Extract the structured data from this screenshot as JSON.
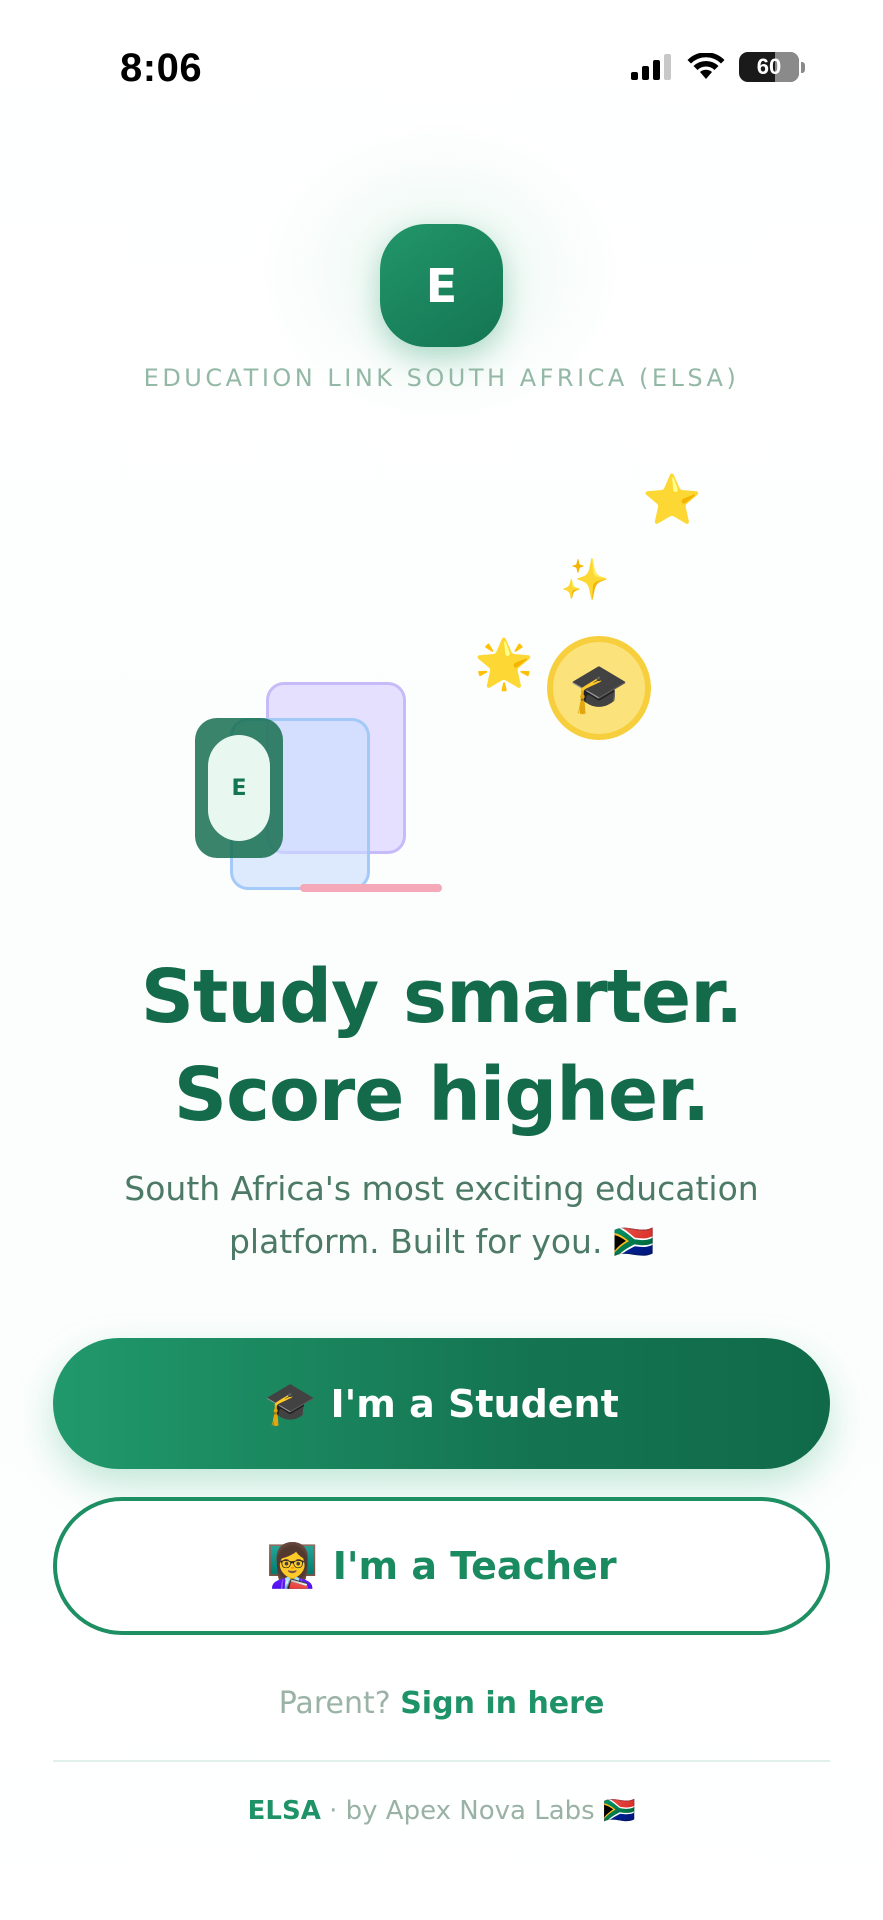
{
  "status_bar": {
    "time": "8:06",
    "battery_percent": "60",
    "icons": [
      "signal-icon",
      "wifi-icon",
      "battery-icon"
    ]
  },
  "brand": {
    "logo_letter": "E",
    "full_name": "EDUCATION LINK SOUTH AFRICA (ELSA)"
  },
  "illustration": {
    "phone_letter": "E",
    "stars": [
      "⭐",
      "✨",
      "🌟"
    ],
    "cap": "🎓"
  },
  "hero": {
    "headline_line1": "Study smarter.",
    "headline_line2": "Score higher.",
    "subtitle_line1": "South Africa's most exciting education",
    "subtitle_line2": "platform. Built for you. 🇿🇦"
  },
  "actions": {
    "student_emoji": "🎓",
    "student_label": "I'm a Student",
    "teacher_emoji": "👩‍🏫",
    "teacher_label": "I'm a Teacher",
    "parent_prompt": "Parent?",
    "parent_link": "Sign in here"
  },
  "footer": {
    "brand": "ELSA",
    "byline": " · by Apex Nova Labs 🇿🇦"
  },
  "colors": {
    "primary": "#1a8a60",
    "primary_dark": "#146b4b",
    "muted": "#9bb3a7"
  }
}
